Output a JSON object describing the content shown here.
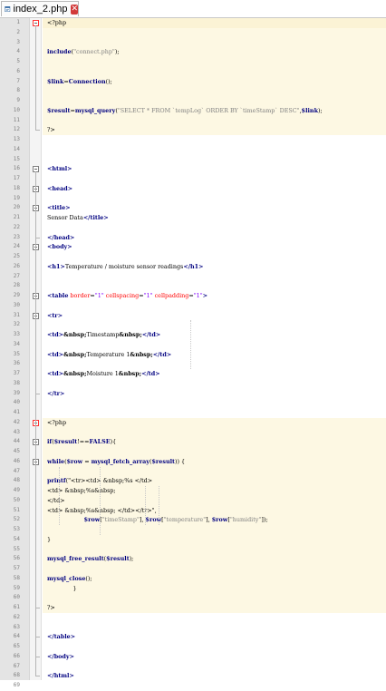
{
  "tab": {
    "filename": "index_2.php",
    "file_icon": "php-file-icon",
    "close_icon": "close-tab-icon"
  },
  "colors": {
    "php_tag": "#ff0000",
    "keyword": "#000080",
    "string": "#808080",
    "highlight": "#fdf8e3",
    "gutter": "#e4e4e4"
  },
  "lines": [
    {
      "n": "1",
      "t": "<?php"
    },
    {
      "n": "2",
      "t": ""
    },
    {
      "n": "3",
      "t": ""
    },
    {
      "n": "4",
      "t": "include(\"connect.php\");"
    },
    {
      "n": "5",
      "t": ""
    },
    {
      "n": "6",
      "t": ""
    },
    {
      "n": "7",
      "t": "$link=Connection();"
    },
    {
      "n": "8",
      "t": ""
    },
    {
      "n": "9",
      "t": ""
    },
    {
      "n": "10",
      "t": "$result=mysql_query(\"SELECT * FROM `tempLog` ORDER BY `timeStamp` DESC\",$link);"
    },
    {
      "n": "11",
      "t": ""
    },
    {
      "n": "12",
      "t": "?>"
    },
    {
      "n": "13",
      "t": ""
    },
    {
      "n": "14",
      "t": ""
    },
    {
      "n": "15",
      "t": ""
    },
    {
      "n": "16",
      "t": "<html>"
    },
    {
      "n": "17",
      "t": ""
    },
    {
      "n": "18",
      "t": "<head>"
    },
    {
      "n": "19",
      "t": ""
    },
    {
      "n": "20",
      "t": "<title>"
    },
    {
      "n": "21",
      "t": "Sensor Data</title>"
    },
    {
      "n": "22",
      "t": ""
    },
    {
      "n": "23",
      "t": "</head>"
    },
    {
      "n": "24",
      "t": "<body>"
    },
    {
      "n": "25",
      "t": ""
    },
    {
      "n": "26",
      "t": "<h1>Temperature / moisture sensor readings</h1>"
    },
    {
      "n": "27",
      "t": ""
    },
    {
      "n": "28",
      "t": ""
    },
    {
      "n": "29",
      "t": "<table border=\"1\" cellspacing=\"1\" cellpadding=\"1\">"
    },
    {
      "n": "30",
      "t": ""
    },
    {
      "n": "31",
      "t": "<tr>"
    },
    {
      "n": "32",
      "t": ""
    },
    {
      "n": "33",
      "t": "<td>&nbsp;Timestamp&nbsp;</td>"
    },
    {
      "n": "34",
      "t": ""
    },
    {
      "n": "35",
      "t": "<td>&nbsp;Temperature 1&nbsp;</td>"
    },
    {
      "n": "36",
      "t": ""
    },
    {
      "n": "37",
      "t": "<td>&nbsp;Moisture 1&nbsp;</td>"
    },
    {
      "n": "38",
      "t": ""
    },
    {
      "n": "39",
      "t": "</tr>"
    },
    {
      "n": "40",
      "t": ""
    },
    {
      "n": "41",
      "t": ""
    },
    {
      "n": "42",
      "t": "<?php"
    },
    {
      "n": "43",
      "t": ""
    },
    {
      "n": "44",
      "t": "if($result!==FALSE){"
    },
    {
      "n": "45",
      "t": ""
    },
    {
      "n": "46",
      "t": "while($row = mysql_fetch_array($result)) {"
    },
    {
      "n": "47",
      "t": ""
    },
    {
      "n": "48",
      "t": "printf(\"<tr><td> &nbsp;%s </td>"
    },
    {
      "n": "49",
      "t": "<td> &nbsp;%s&nbsp;"
    },
    {
      "n": "50",
      "t": "</td>"
    },
    {
      "n": "51",
      "t": "<td> &nbsp;%s&nbsp; </td></tr>\","
    },
    {
      "n": "52",
      "t": "                    $row[\"timeStamp\"], $row[\"temperature\"], $row[\"humidity\"]);"
    },
    {
      "n": "53",
      "t": ""
    },
    {
      "n": "54",
      "t": "}"
    },
    {
      "n": "55",
      "t": ""
    },
    {
      "n": "56",
      "t": "mysql_free_result($result);"
    },
    {
      "n": "57",
      "t": ""
    },
    {
      "n": "58",
      "t": "mysql_close();"
    },
    {
      "n": "59",
      "t": "              }"
    },
    {
      "n": "60",
      "t": ""
    },
    {
      "n": "61",
      "t": "?>"
    },
    {
      "n": "62",
      "t": ""
    },
    {
      "n": "63",
      "t": ""
    },
    {
      "n": "64",
      "t": "</table>"
    },
    {
      "n": "65",
      "t": ""
    },
    {
      "n": "66",
      "t": "</body>"
    },
    {
      "n": "67",
      "t": ""
    },
    {
      "n": "68",
      "t": "</html>"
    },
    {
      "n": "69",
      "t": ""
    }
  ]
}
